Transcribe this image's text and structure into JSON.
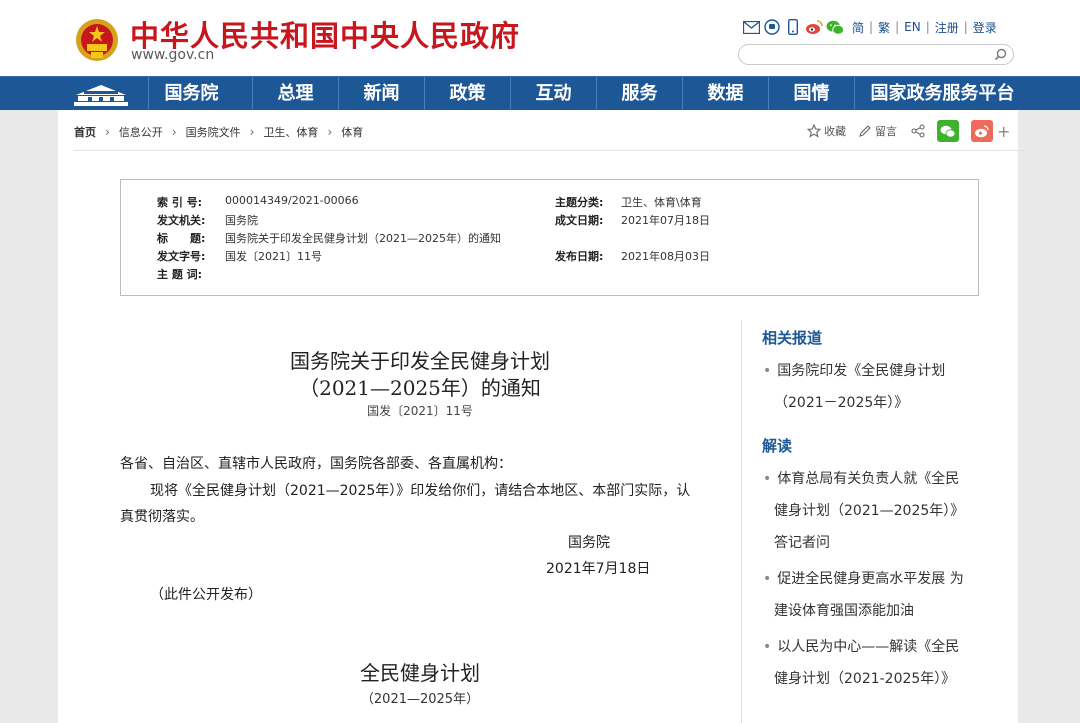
{
  "header": {
    "site_title": "中华人民共和国中央人民政府",
    "site_domain": "www.gov.cn",
    "links": [
      "简",
      "繁",
      "EN",
      "注册",
      "登录"
    ],
    "icons": [
      "mail-icon",
      "chat-icon",
      "mobile-icon",
      "weibo-icon",
      "wechat-icon"
    ],
    "search_placeholder": ""
  },
  "nav": {
    "items": [
      "国务院",
      "总理",
      "新闻",
      "政策",
      "互动",
      "服务",
      "数据",
      "国情",
      "国家政务服务平台"
    ]
  },
  "breadcrumb": [
    "首页",
    "信息公开",
    "国务院文件",
    "卫生、体育",
    "体育"
  ],
  "tools": {
    "collect": "收藏",
    "comment": "留言",
    "more": "+"
  },
  "meta": {
    "index_no_key": "索 引 号:",
    "index_no": "000014349/2021-00066",
    "category_key": "主题分类:",
    "category": "卫生、体育\\体育",
    "issuer_key": "发文机关:",
    "issuer": "国务院",
    "created_key": "成文日期:",
    "created": "2021年07月18日",
    "title_key": "标　　题:",
    "title": "国务院关于印发全民健身计划（2021—2025年）的通知",
    "docno_key": "发文字号:",
    "docno": "国发〔2021〕11号",
    "published_key": "发布日期:",
    "published": "2021年08月03日",
    "subject_key": "主 题 词:",
    "subject": ""
  },
  "article": {
    "title_line1": "国务院关于印发全民健身计划",
    "title_line2": "（2021—2025年）的通知",
    "doc_number": "国发〔2021〕11号",
    "salutation": "各省、自治区、直辖市人民政府，国务院各部委、各直属机构：",
    "body_line1": "现将《全民健身计划（2021—2025年）》印发给你们，请结合本地区、本部门实际，认",
    "body_line2": "真贯彻落实。",
    "signer": "国务院",
    "sign_date": "2021年7月18日",
    "public_note": "（此件公开发布）",
    "plan_title": "全民健身计划",
    "plan_subtitle": "（2021—2025年）"
  },
  "sidebar": {
    "related_head": "相关报道",
    "related_1a": "国务院印发《全民健身计划",
    "related_1b": "（2021－2025年）》",
    "interpret_head": "解读",
    "interp_1a": "体育总局有关负责人就《全民",
    "interp_1b": "健身计划（2021—2025年）》",
    "interp_1c": "答记者问",
    "interp_2a": "促进全民健身更高水平发展 为",
    "interp_2b": "建设体育强国添能加油",
    "interp_3a": "以人民为中心——解读《全民",
    "interp_3b": "健身计划（2021-2025年）》",
    "bullet": "•"
  },
  "colors": {
    "nav_blue": "#1d5796",
    "title_red": "#c8161d",
    "link_blue": "#1d5796"
  }
}
